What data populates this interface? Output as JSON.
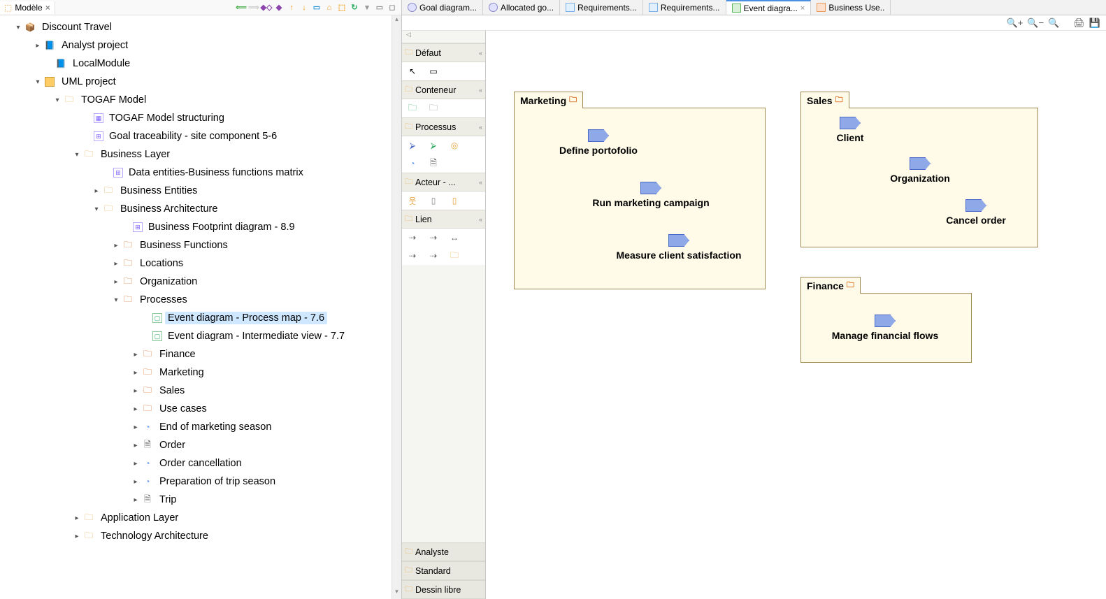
{
  "left_view": {
    "title": "Modèle"
  },
  "tree": {
    "root": "Discount Travel",
    "analyst": "Analyst project",
    "local_module": "LocalModule",
    "uml": "UML project",
    "togaf": "TOGAF Model",
    "togaf_struct": "TOGAF Model structuring",
    "goal_trace": "Goal traceability - site component 5-6",
    "biz_layer": "Business Layer",
    "data_matrix": "Data entities-Business functions matrix",
    "biz_entities": "Business Entities",
    "biz_arch": "Business Architecture",
    "footprint": "Business Footprint diagram - 8.9",
    "biz_func": "Business Functions",
    "locations": "Locations",
    "organization": "Organization",
    "processes": "Processes",
    "ev_map": "Event diagram - Process map - 7.6",
    "ev_inter": "Event diagram - Intermediate view - 7.7",
    "finance": "Finance",
    "marketing": "Marketing",
    "sales": "Sales",
    "usecases": "Use cases",
    "end_season": "End of marketing season",
    "order": "Order",
    "order_cancel": "Order cancellation",
    "prep_trip": "Preparation of trip season",
    "trip": "Trip",
    "app_layer": "Application Layer",
    "tech_arch": "Technology Architecture"
  },
  "tabs": {
    "t1": "Goal diagram...",
    "t2": "Allocated go...",
    "t3": "Requirements...",
    "t4": "Requirements...",
    "t5": "Event diagra...",
    "t6": "Business Use.."
  },
  "palette": {
    "defaut": "Défaut",
    "conteneur": "Conteneur",
    "processus": "Processus",
    "acteur": "Acteur - ...",
    "lien": "Lien",
    "analyste": "Analyste",
    "standard": "Standard",
    "dessin": "Dessin libre"
  },
  "diagram": {
    "pkg_marketing": "Marketing",
    "pkg_sales": "Sales",
    "pkg_finance": "Finance",
    "define_portfolio": "Define portofolio",
    "run_campaign": "Run marketing campaign",
    "measure_sat": "Measure client satisfaction",
    "client": "Client",
    "organization": "Organization",
    "cancel_order": "Cancel order",
    "manage_flows": "Manage financial flows"
  }
}
